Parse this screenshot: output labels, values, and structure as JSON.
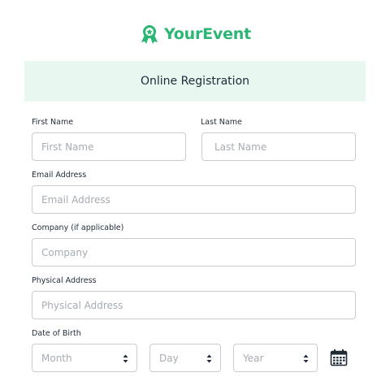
{
  "brand": {
    "name": "YourEvent",
    "icon": "award-ribbon-icon",
    "color": "#2bb673"
  },
  "banner": {
    "title": "Online Registration"
  },
  "form": {
    "first_name": {
      "label": "First Name",
      "placeholder": "First Name",
      "value": ""
    },
    "last_name": {
      "label": "Last Name",
      "placeholder": "Last Name",
      "value": ""
    },
    "email": {
      "label": "Email Address",
      "placeholder": "Email Address",
      "value": ""
    },
    "company": {
      "label": "Company (if applicable)",
      "placeholder": "Company",
      "value": ""
    },
    "address": {
      "label": "Physical Address",
      "placeholder": "Physical Address",
      "value": ""
    },
    "dob": {
      "label": "Date of Birth",
      "month": {
        "placeholder": "Month"
      },
      "day": {
        "placeholder": "Day"
      },
      "year": {
        "placeholder": "Year"
      },
      "picker_icon": "calendar-icon"
    }
  }
}
